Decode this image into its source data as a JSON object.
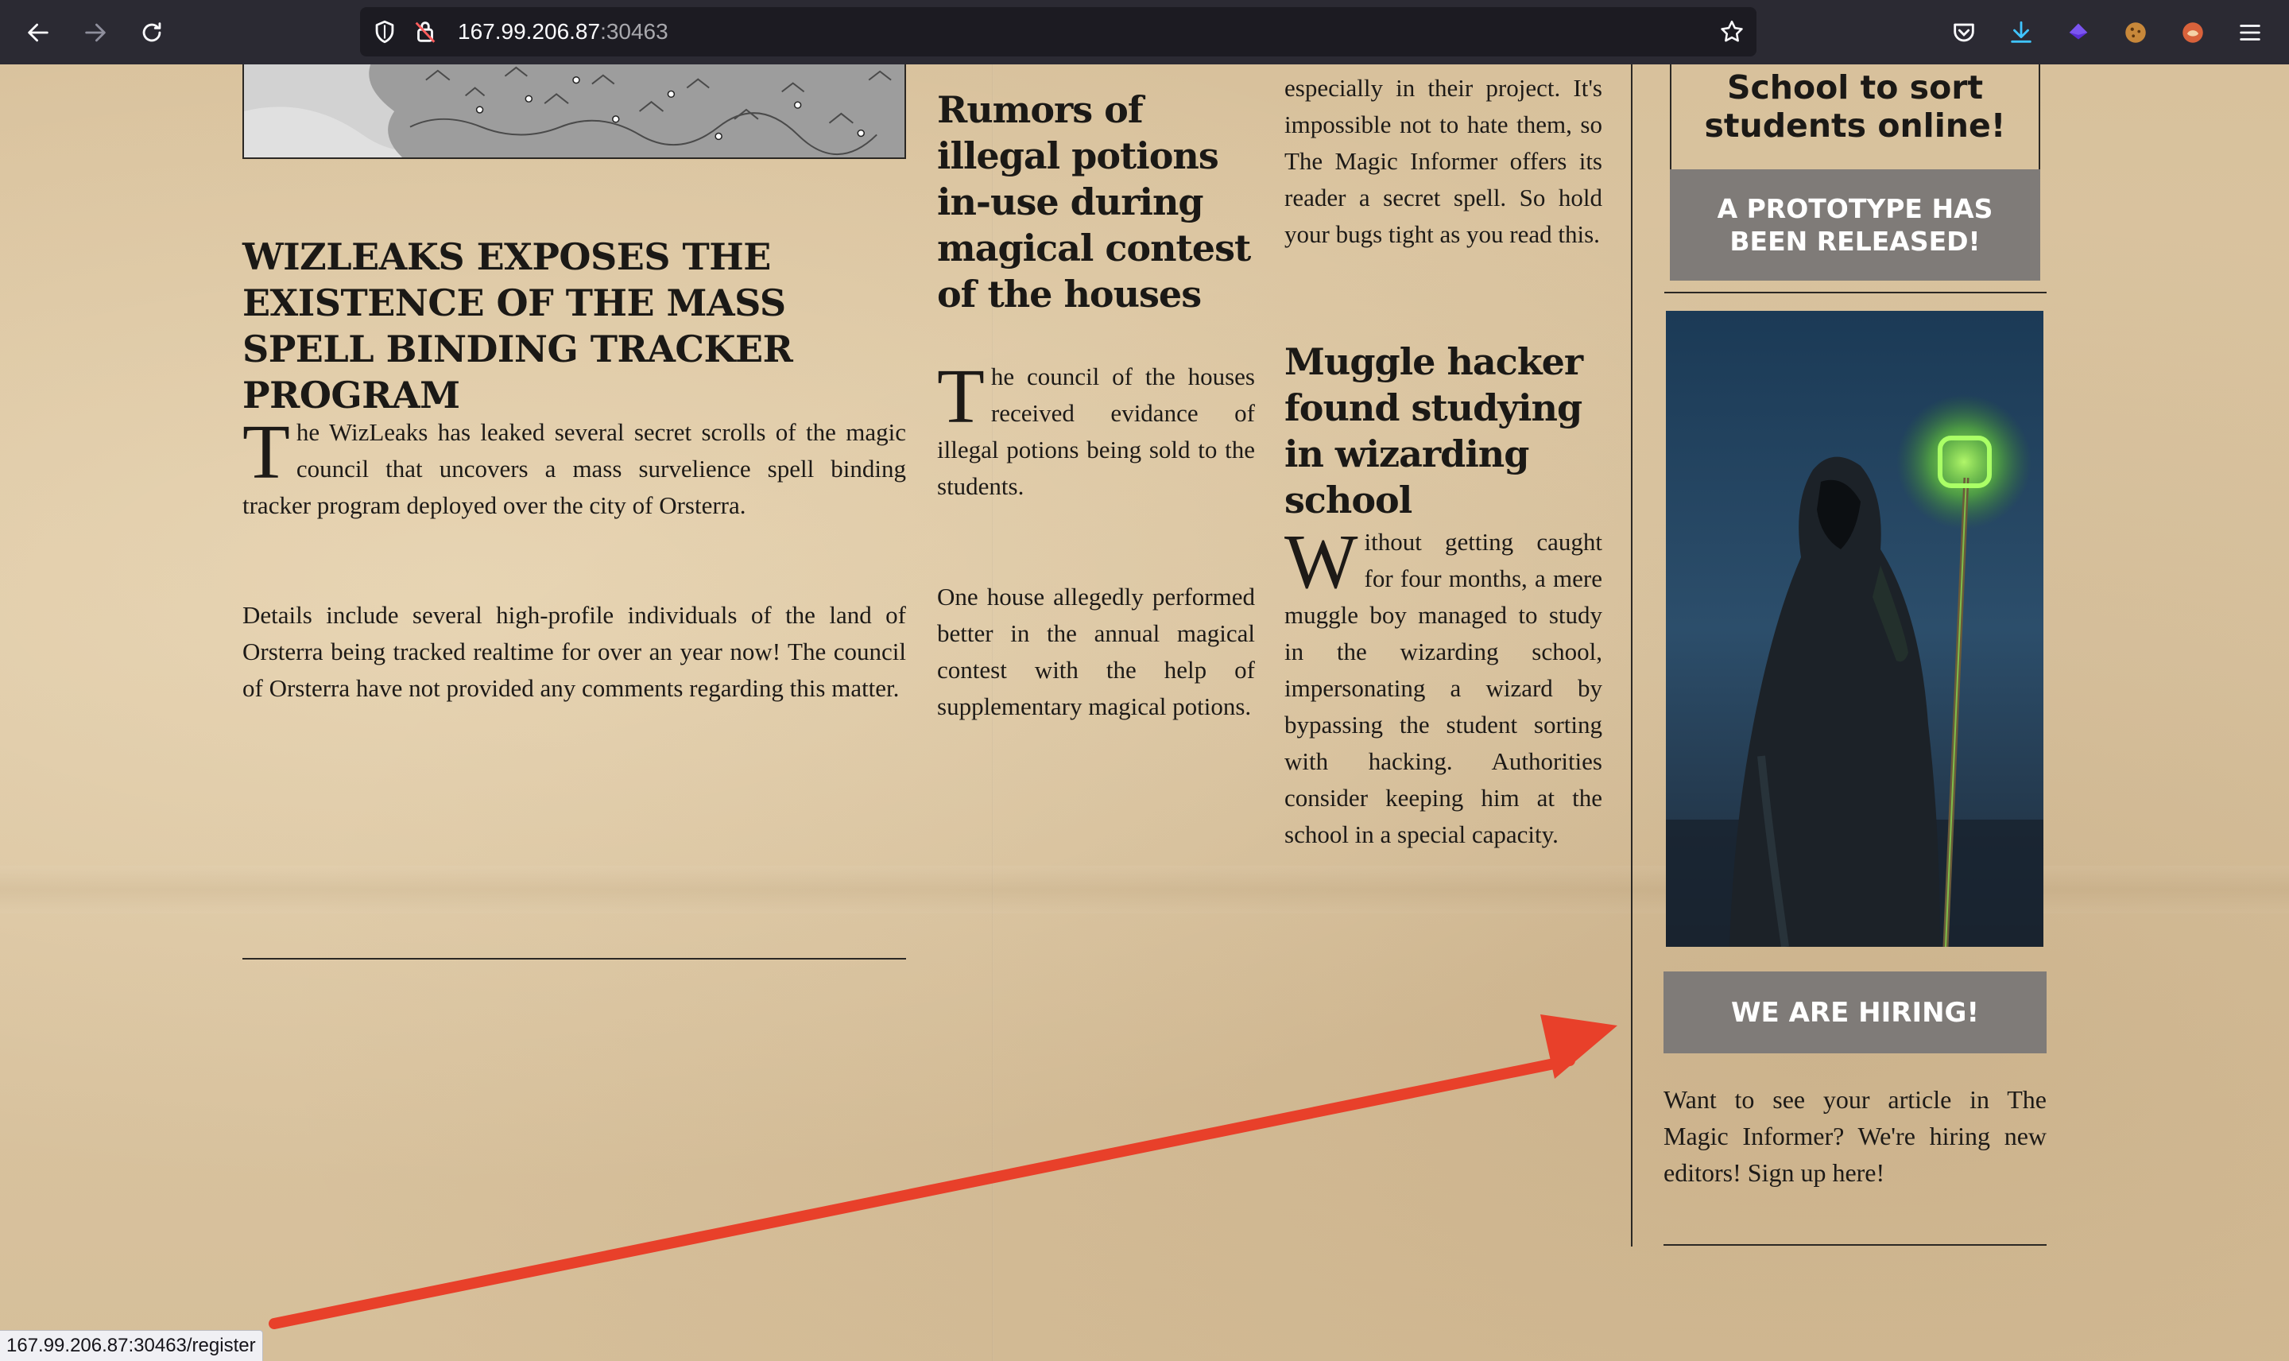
{
  "browser": {
    "url_host": "167.99.206.87",
    "url_port": ":30463",
    "status_url": "167.99.206.87:30463/register"
  },
  "articles": {
    "main": {
      "headline": "WIZLEAKS EXPOSES THE EXISTENCE OF THE MASS SPELL BINDING TRACKER PROGRAM",
      "dropcap": "T",
      "p1": "he WizLeaks has leaked several secret scrolls of the magic council that uncovers a mass survelience spell binding tracker program deployed over the city of Orsterra.",
      "p2": "Details include several high-profile individuals of the land of Orsterra being tracked realtime for over an year now! The council of Orsterra have not provided any comments regarding this matter."
    },
    "potions": {
      "headline": "Rumors of illegal potions in-use during magical contest of the houses",
      "dropcap": "T",
      "p1": "he council of the houses received evidance of illegal potions being sold to the students.",
      "p2": "One house allegedly performed better in the annual magical contest with the help of supplementary magical potions."
    },
    "bugs_tail": "especially in their project. It's impossible not to hate them, so The Magic Informer offers its reader a secret spell. So hold your bugs tight as you read this.",
    "muggle": {
      "headline": "Muggle hacker found studying in wizarding school",
      "dropcap": "W",
      "p1": "ithout getting caught for four months, a mere muggle boy managed to study in the wizarding school, impersonating a wizard by bypassing the student sorting with hacking. Authorities consider keeping him at the school in a special capacity."
    }
  },
  "sidebar": {
    "promo_text_partial": "School to sort students online!",
    "prototype_button": "A PROTOTYPE HAS BEEN RELEASED!",
    "hiring_button": "WE ARE HIRING!",
    "hiring_text": "Want to see your article in The Magic Informer? We're hiring new editors! Sign up here!"
  },
  "colors": {
    "paper": "#dcc5a0",
    "button_gray": "#7f7b78",
    "arrow_red": "#e8402a",
    "chrome_dark": "#2b2a33"
  },
  "icons": [
    "back-icon",
    "forward-icon",
    "reload-icon",
    "shield-icon",
    "lock-strikethrough-icon",
    "star-icon",
    "pocket-icon",
    "download-icon",
    "extension-icon",
    "cookie-icon",
    "avatar-extension-icon",
    "menu-icon"
  ]
}
